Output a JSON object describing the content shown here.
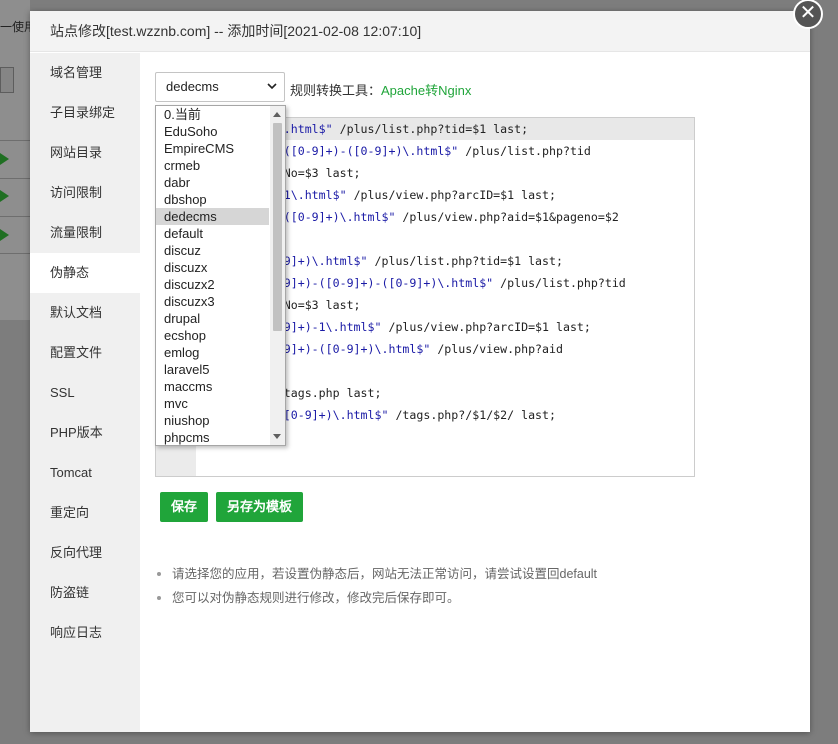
{
  "background": {
    "side_text": "一使用"
  },
  "modal": {
    "title": "站点修改[test.wzznb.com] -- 添加时间[2021-02-08 12:07:10]"
  },
  "sidebar": {
    "items": [
      {
        "label": "域名管理"
      },
      {
        "label": "子目录绑定"
      },
      {
        "label": "网站目录"
      },
      {
        "label": "访问限制"
      },
      {
        "label": "流量限制"
      },
      {
        "label": "伪静态"
      },
      {
        "label": "默认文档"
      },
      {
        "label": "配置文件"
      },
      {
        "label": "SSL"
      },
      {
        "label": "PHP版本"
      },
      {
        "label": "Tomcat"
      },
      {
        "label": "重定向"
      },
      {
        "label": "反向代理"
      },
      {
        "label": "防盗链"
      },
      {
        "label": "响应日志"
      }
    ],
    "active_label": "伪静态"
  },
  "rewrite": {
    "selected": "dedecms",
    "tool_label": "规则转换工具：",
    "tool_link": "Apache转Nginx",
    "options": [
      "0.当前",
      "EduSoho",
      "EmpireCMS",
      "crmeb",
      "dabr",
      "dbshop",
      "dedecms",
      "default",
      "discuz",
      "discuzx",
      "discuzx2",
      "discuzx3",
      "drupal",
      "ecshop",
      "emlog",
      "laravel5",
      "maccms",
      "mvc",
      "niushop",
      "phpcms"
    ]
  },
  "editor": {
    "lines": [
      {
        "pre": "",
        "str": "st-([0-9]+)\\.html$\"",
        "post": " /plus/list.php?tid=$1 last;"
      },
      {
        "pre": "",
        "str": "st-([0-9]+)-([0-9]+)-([0-9]+)\\.html$\"",
        "post": " /plus/list.php?tid"
      },
      {
        "pre": "sult=$2&PageNo=$3 last;",
        "str": "",
        "post": ""
      },
      {
        "pre": "",
        "str": "ew-([0-9]+)-1\\.html$\"",
        "post": " /plus/view.php?arcID=$1 last;"
      },
      {
        "pre": "",
        "str": "ew-([0-9]+)-([0-9]+)\\.html$\"",
        "post": " /plus/view.php?aid=$1&pageno=$2"
      },
      {
        "pre": "",
        "str": "",
        "post": ""
      },
      {
        "pre": "",
        "str": "us/list-([0-9]+)\\.html$\"",
        "post": " /plus/list.php?tid=$1 last;"
      },
      {
        "pre": "",
        "str": "us/list-([0-9]+)-([0-9]+)-([0-9]+)\\.html$\"",
        "post": " /plus/list.php?tid"
      },
      {
        "pre": "sult=$2&PageNo=$3 last;",
        "str": "",
        "post": ""
      },
      {
        "pre": "",
        "str": "us/view-([0-9]+)-1\\.html$\"",
        "post": " /plus/view.php?arcID=$1 last;"
      },
      {
        "pre": "",
        "str": "us/view-([0-9]+)-([0-9]+)\\.html$\"",
        "post": " /plus/view.php?aid"
      },
      {
        "pre": "$2 last;",
        "str": "",
        "post": ""
      },
      {
        "pre": "",
        "str": "ags.html$\"",
        "post": " /tags.php last;"
      },
      {
        "pre": "",
        "str": "g-([0-9]+)-([0-9]+)\\.html$\"",
        "post": " /tags.php?/$1/$2/ last;"
      }
    ]
  },
  "buttons": {
    "save": "保存",
    "save_template": "另存为模板"
  },
  "tips": [
    "请选择您的应用，若设置伪静态后，网站无法正常访问，请尝试设置回default",
    "您可以对伪静态规则进行修改，修改完后保存即可。"
  ],
  "colors": {
    "accent": "#20a53a",
    "code_string": "#1a1aa6"
  }
}
